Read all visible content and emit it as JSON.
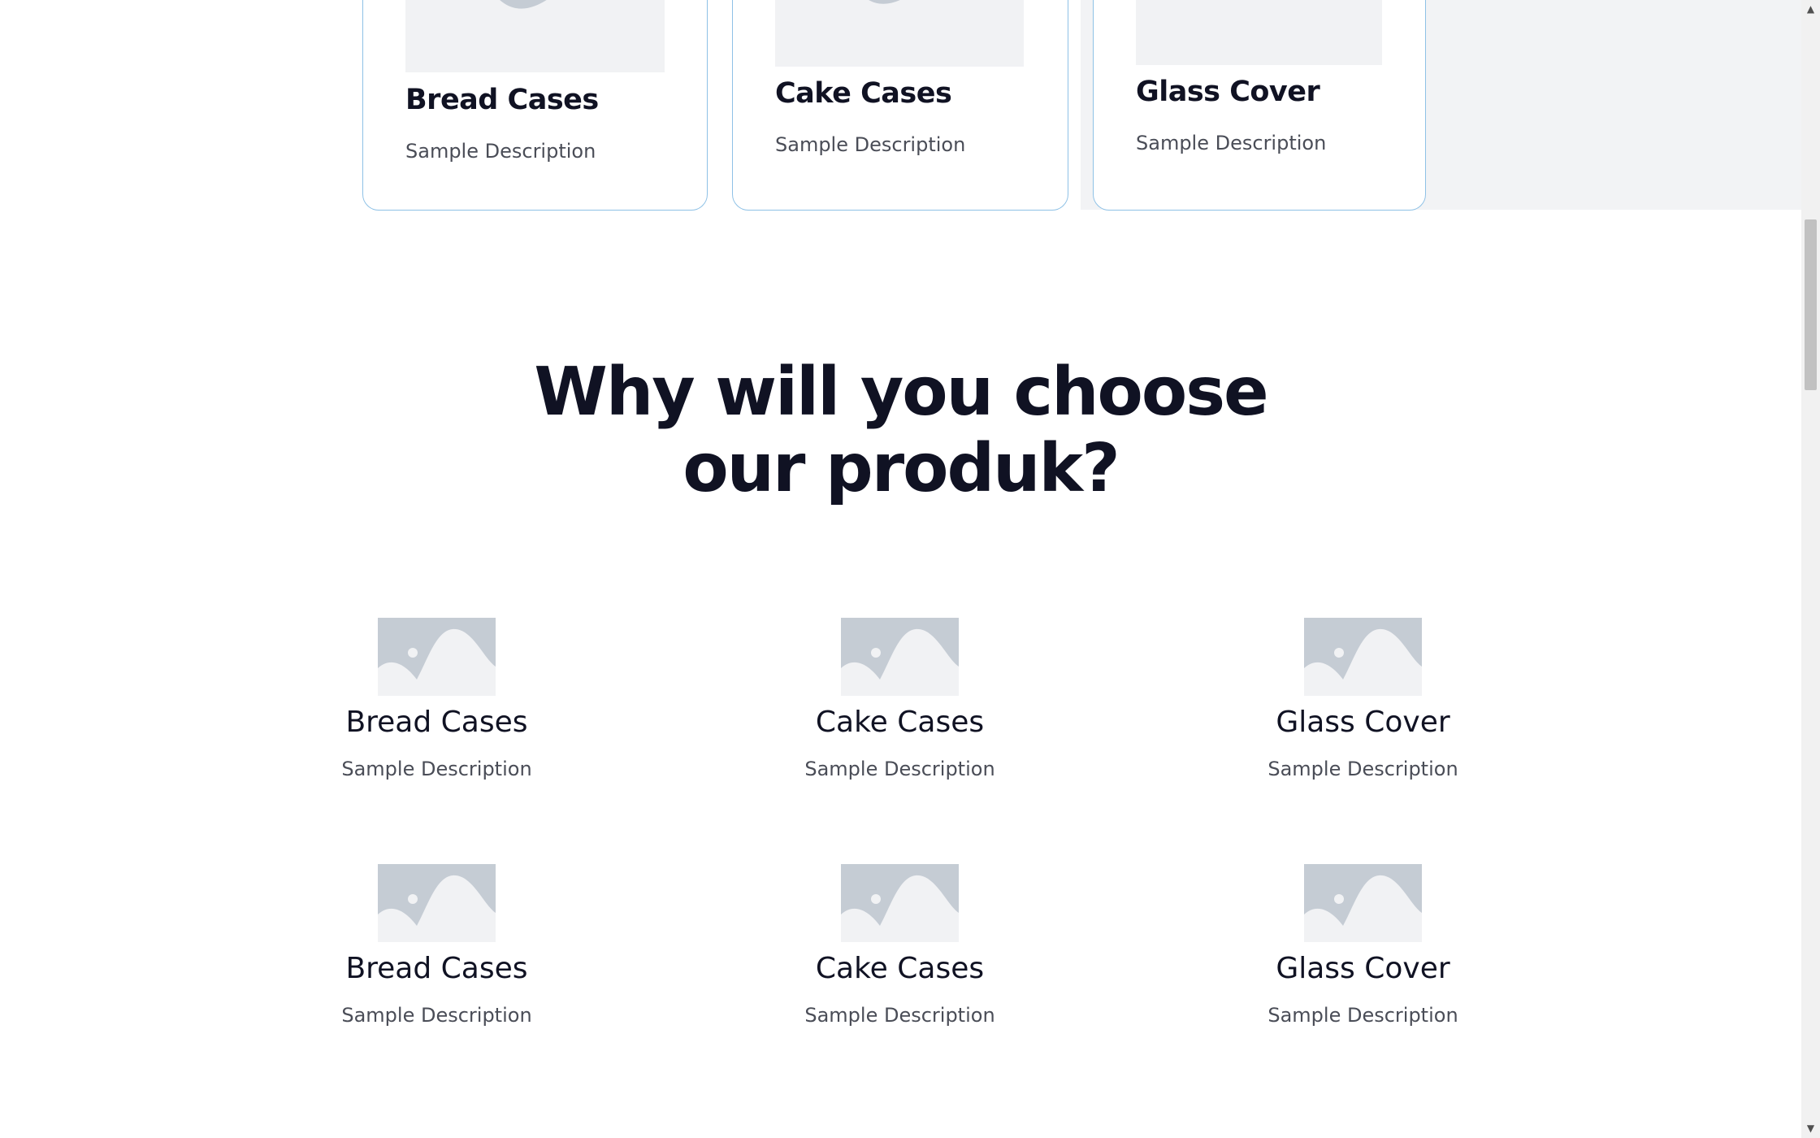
{
  "top_cards": [
    {
      "title": "Bread Cases",
      "description": "Sample Description",
      "image_icon": "image-placeholder-icon"
    },
    {
      "title": "Cake Cases",
      "description": "Sample Description",
      "image_icon": "image-placeholder-icon"
    },
    {
      "title": "Glass Cover",
      "description": "Sample Description",
      "image_icon": "image-placeholder-icon"
    }
  ],
  "section": {
    "title_line1": "Why will you choose",
    "title_line2": "our produk?"
  },
  "features": [
    {
      "title": "Bread Cases",
      "description": "Sample Description"
    },
    {
      "title": "Cake Cases",
      "description": "Sample Description"
    },
    {
      "title": "Glass Cover",
      "description": "Sample Description"
    },
    {
      "title": "Bread Cases",
      "description": "Sample Description"
    },
    {
      "title": "Cake Cases",
      "description": "Sample Description"
    },
    {
      "title": "Glass Cover",
      "description": "Sample Description"
    }
  ],
  "scrollbar": {
    "up_icon": "scroll-up-arrow-icon",
    "down_icon": "scroll-down-arrow-icon"
  },
  "colors": {
    "heading": "#101223",
    "body_text": "#4a4d57",
    "card_border": "#8ec1e6",
    "placeholder_light": "#f1f2f4",
    "placeholder_dark": "#c5ccd4",
    "gray_band": "#f2f3f5"
  }
}
